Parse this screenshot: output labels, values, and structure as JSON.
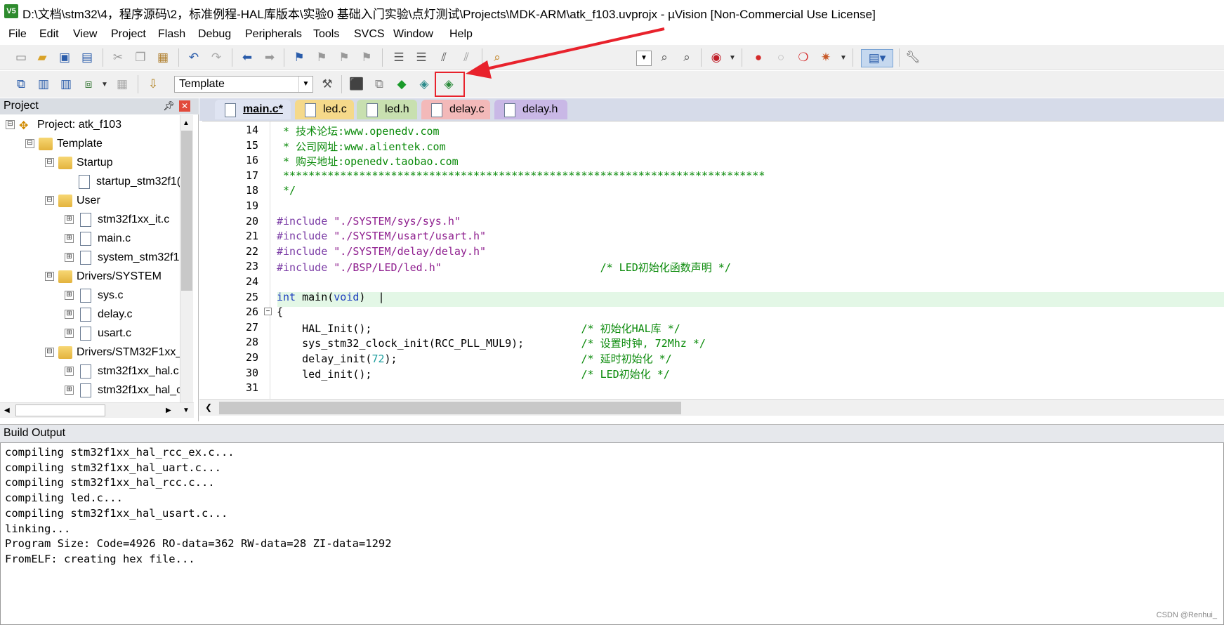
{
  "window": {
    "app_icon_text": "V5",
    "title": "D:\\文档\\stm32\\4，程序源码\\2，标准例程-HAL库版本\\实验0 基础入门实验\\点灯测试\\Projects\\MDK-ARM\\atk_f103.uvprojx - µVision  [Non-Commercial Use License]"
  },
  "menu": [
    "File",
    "Edit",
    "View",
    "Project",
    "Flash",
    "Debug",
    "Peripherals",
    "Tools",
    "SVCS",
    "Window",
    "Help"
  ],
  "toolbar2": {
    "target": "Template"
  },
  "project_panel": {
    "title": "Project",
    "tree": [
      {
        "label": "Project: atk_f103",
        "type": "project",
        "expanded": "⊟"
      },
      {
        "label": "Template",
        "type": "target",
        "expanded": "⊟"
      },
      {
        "label": "Startup",
        "type": "folder",
        "expanded": "⊟"
      },
      {
        "label": "startup_stm32f1(",
        "type": "file",
        "expanded": ""
      },
      {
        "label": "User",
        "type": "folder",
        "expanded": "⊟"
      },
      {
        "label": "stm32f1xx_it.c",
        "type": "file",
        "expanded": "⊞"
      },
      {
        "label": "main.c",
        "type": "file",
        "expanded": "⊞"
      },
      {
        "label": "system_stm32f1:",
        "type": "file",
        "expanded": "⊞"
      },
      {
        "label": "Drivers/SYSTEM",
        "type": "folder",
        "expanded": "⊟"
      },
      {
        "label": "sys.c",
        "type": "file",
        "expanded": "⊞"
      },
      {
        "label": "delay.c",
        "type": "file",
        "expanded": "⊞"
      },
      {
        "label": "usart.c",
        "type": "file",
        "expanded": "⊞"
      },
      {
        "label": "Drivers/STM32F1xx_",
        "type": "folder",
        "expanded": "⊟"
      },
      {
        "label": "stm32f1xx_hal.c",
        "type": "file",
        "expanded": "⊞"
      },
      {
        "label": "stm32f1xx_hal_c",
        "type": "file",
        "expanded": "⊞"
      }
    ]
  },
  "tabs": [
    {
      "label": "main.c*",
      "color": "#dfe4f2",
      "active": true
    },
    {
      "label": "led.c",
      "color": "#f5d98a",
      "active": false
    },
    {
      "label": "led.h",
      "color": "#c8e0b0",
      "active": false
    },
    {
      "label": "delay.c",
      "color": "#f3b9b9",
      "active": false
    },
    {
      "label": "delay.h",
      "color": "#c9b8e6",
      "active": false
    }
  ],
  "code_lines": [
    {
      "n": "14",
      "segs": [
        [
          " * 技术论坛:www.openedv.com",
          "c-comment"
        ]
      ]
    },
    {
      "n": "15",
      "segs": [
        [
          " * 公司网址:www.alientek.com",
          "c-comment"
        ]
      ]
    },
    {
      "n": "16",
      "segs": [
        [
          " * 购买地址:openedv.taobao.com",
          "c-comment"
        ]
      ]
    },
    {
      "n": "17",
      "segs": [
        [
          " ****************************************************************************",
          "c-comment"
        ]
      ]
    },
    {
      "n": "18",
      "segs": [
        [
          " */",
          "c-comment"
        ]
      ]
    },
    {
      "n": "19",
      "segs": []
    },
    {
      "n": "20",
      "segs": [
        [
          "#include ",
          "c-pre"
        ],
        [
          "\"./SYSTEM/sys/sys.h\"",
          "c-str"
        ]
      ]
    },
    {
      "n": "21",
      "segs": [
        [
          "#include ",
          "c-pre"
        ],
        [
          "\"./SYSTEM/usart/usart.h\"",
          "c-str"
        ]
      ]
    },
    {
      "n": "22",
      "segs": [
        [
          "#include ",
          "c-pre"
        ],
        [
          "\"./SYSTEM/delay/delay.h\"",
          "c-str"
        ]
      ]
    },
    {
      "n": "23",
      "segs": [
        [
          "#include ",
          "c-pre"
        ],
        [
          "\"./BSP/LED/led.h\"",
          "c-str"
        ],
        [
          "                         /* LED初始化函数声明 */",
          "c-comment"
        ]
      ]
    },
    {
      "n": "24",
      "segs": []
    },
    {
      "n": "25",
      "segs": [
        [
          "int",
          "c-kw"
        ],
        [
          " main(",
          ""
        ],
        [
          "void",
          "c-kw"
        ],
        [
          ")  |",
          ""
        ]
      ]
    },
    {
      "n": "26",
      "segs": [
        [
          "{",
          ""
        ]
      ]
    },
    {
      "n": "27",
      "segs": [
        [
          "    HAL_Init();                                 ",
          ""
        ],
        [
          "/* 初始化HAL库 */",
          "c-comment"
        ]
      ]
    },
    {
      "n": "28",
      "segs": [
        [
          "    sys_stm32_clock_init(RCC_PLL_MUL9);         ",
          ""
        ],
        [
          "/* 设置时钟, 72Mhz */",
          "c-comment"
        ]
      ]
    },
    {
      "n": "29",
      "segs": [
        [
          "    delay_init(",
          ""
        ],
        [
          "72",
          "c-num"
        ],
        [
          ");                             ",
          ""
        ],
        [
          "/* 延时初始化 */",
          "c-comment"
        ]
      ]
    },
    {
      "n": "30",
      "segs": [
        [
          "    led_init();                                 ",
          ""
        ],
        [
          "/* LED初始化 */",
          "c-comment"
        ]
      ]
    },
    {
      "n": "31",
      "segs": []
    }
  ],
  "build_output": {
    "title": "Build Output",
    "lines": [
      "compiling stm32f1xx_hal_rcc_ex.c...",
      "compiling stm32f1xx_hal_uart.c...",
      "compiling stm32f1xx_hal_rcc.c...",
      "compiling led.c...",
      "compiling stm32f1xx_hal_usart.c...",
      "linking...",
      "Program Size: Code=4926 RO-data=362 RW-data=28 ZI-data=1292",
      "FromELF: creating hex file..."
    ]
  },
  "watermark": "CSDN @Renhui_",
  "annotation": {
    "color": "#e8222c"
  }
}
